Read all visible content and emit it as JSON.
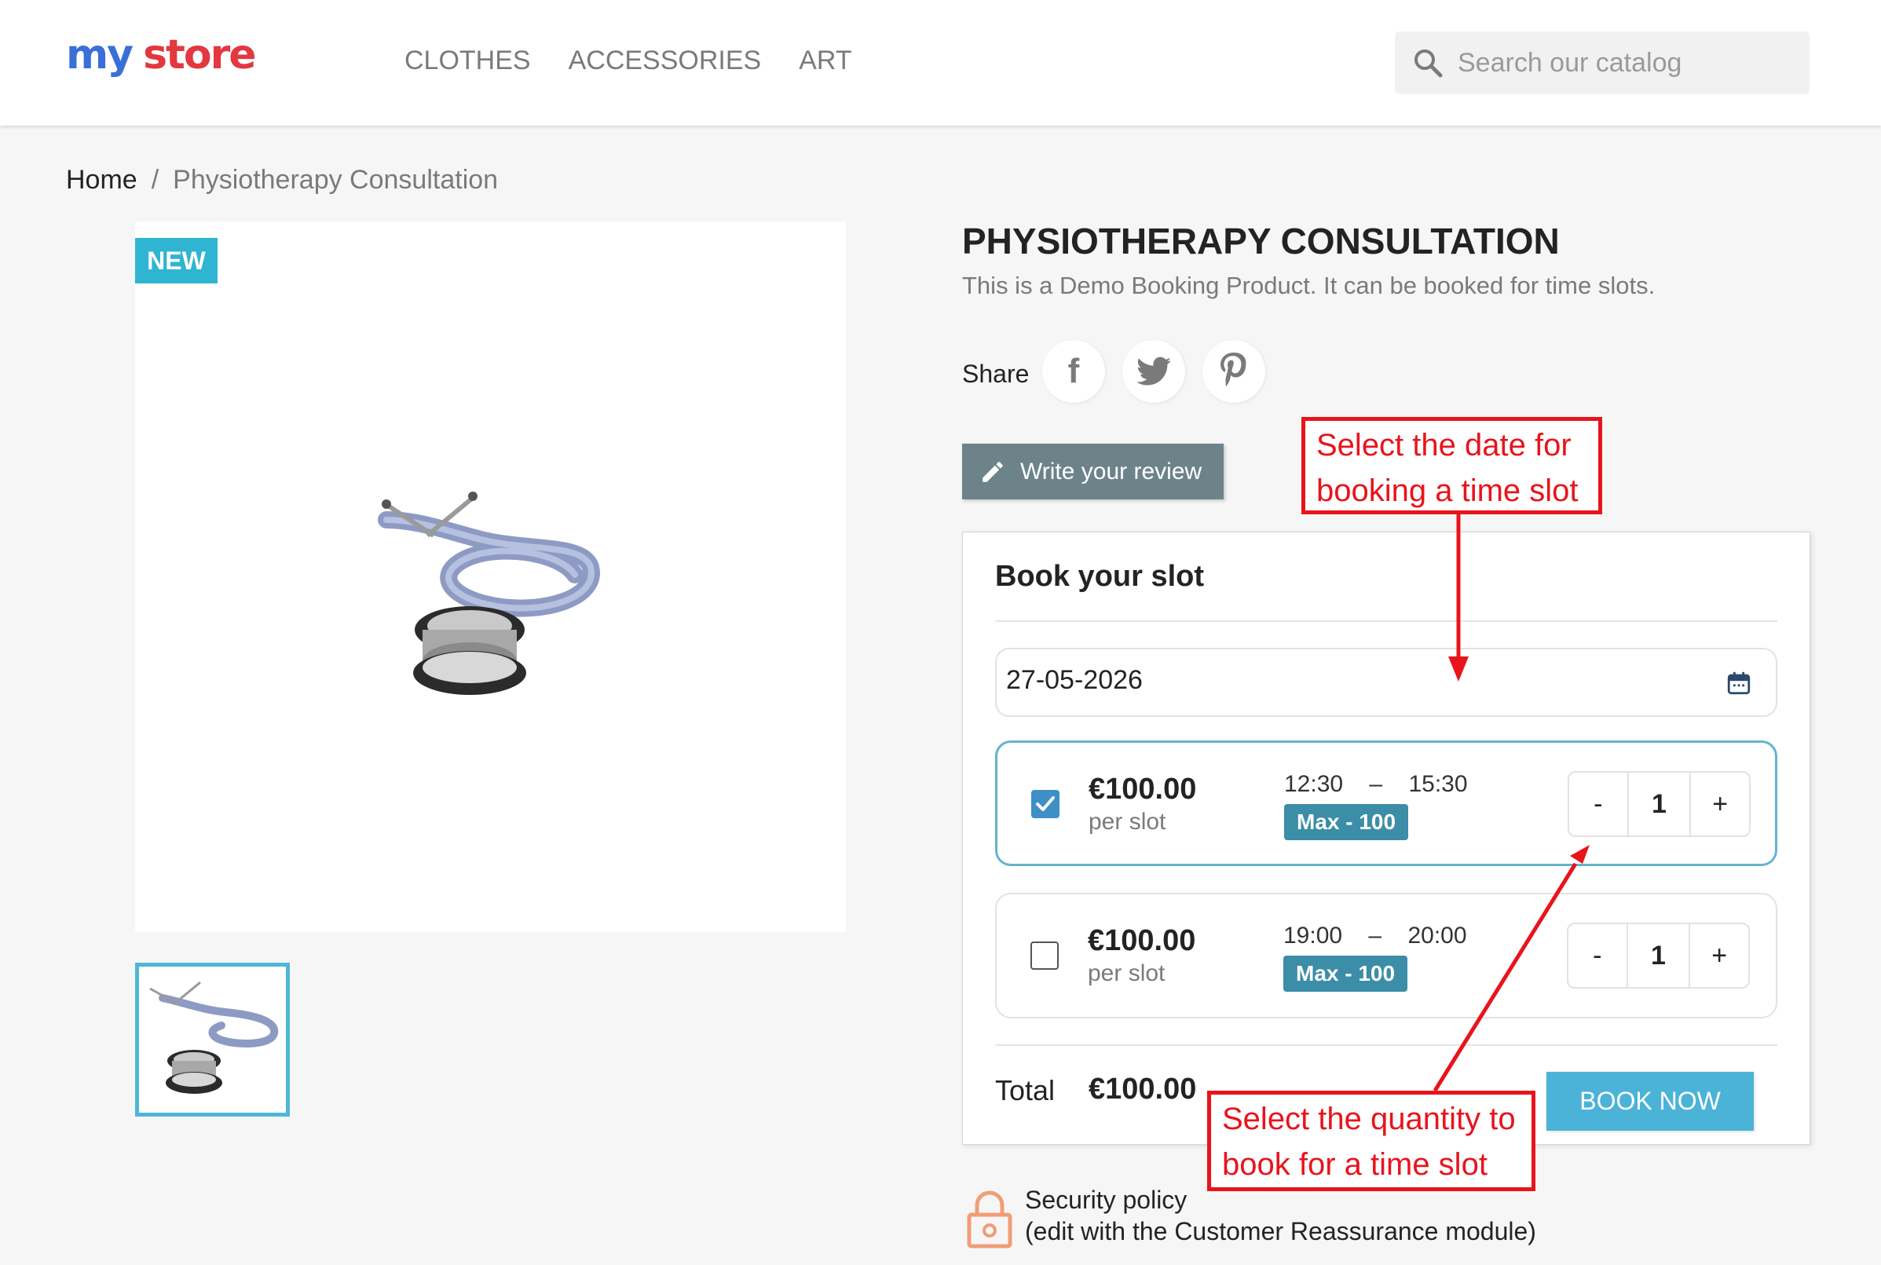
{
  "header": {
    "logo_part1": "my",
    "logo_part2": "store",
    "nav": [
      "CLOTHES",
      "ACCESSORIES",
      "ART"
    ],
    "search_placeholder": "Search our catalog"
  },
  "breadcrumb": {
    "home": "Home",
    "separator": "/",
    "current": "Physiotherapy Consultation"
  },
  "product": {
    "badge": "NEW",
    "title": "PHYSIOTHERAPY CONSULTATION",
    "description": "This is a Demo Booking Product. It can be booked for time slots.",
    "share_label": "Share",
    "social": [
      "f",
      "t",
      "p"
    ],
    "review_button": "Write your review"
  },
  "booking": {
    "title": "Book your slot",
    "date": "27-05-2026",
    "slots": [
      {
        "checked": true,
        "price": "€100.00",
        "per": "per slot",
        "start": "12:30",
        "end": "15:30",
        "max": "Max - 100",
        "qty": "1"
      },
      {
        "checked": false,
        "price": "€100.00",
        "per": "per slot",
        "start": "19:00",
        "end": "20:00",
        "max": "Max - 100",
        "qty": "1"
      }
    ],
    "stepper_minus": "-",
    "stepper_plus": "+",
    "time_dash": "–",
    "total_label": "Total",
    "total_value": "€100.00",
    "book_button": "BOOK NOW"
  },
  "reassurance": {
    "line1": "Security policy",
    "line2": "(edit with the Customer Reassurance module)"
  },
  "annotations": {
    "date_note_line1": "Select the date for",
    "date_note_line2": "booking a time slot",
    "qty_note_line1": "Select the quantity to",
    "qty_note_line2": "book for a time slot"
  },
  "colors": {
    "accent": "#2fb5d2",
    "annotation": "#e8141c",
    "max_badge": "#3c8da8",
    "review_button": "#6d838a"
  }
}
